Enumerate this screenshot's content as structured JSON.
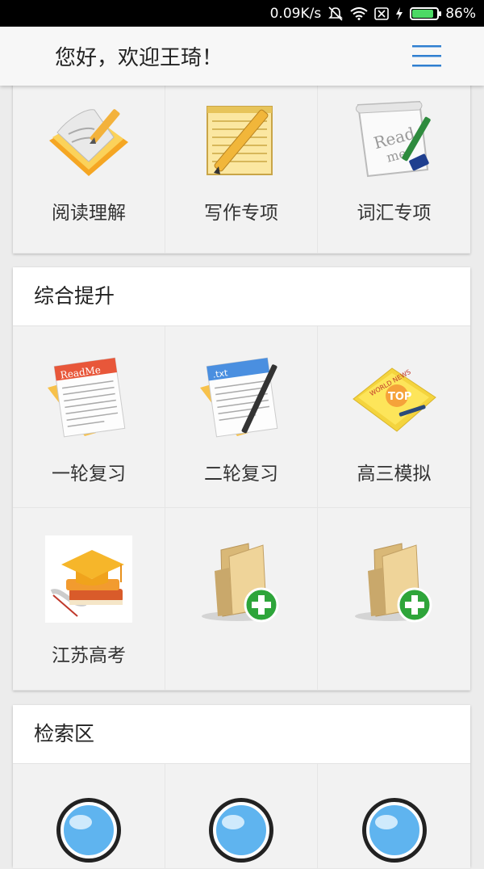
{
  "status_bar": {
    "speed": "0.09K/s",
    "battery": "86%",
    "battery_level": 0.86
  },
  "header": {
    "greeting": "您好，欢迎王琦！",
    "menu_icon": "hamburger-menu-icon"
  },
  "top_card": {
    "items": [
      {
        "label": "阅读理解",
        "icon": "reading-notebook-icon"
      },
      {
        "label": "写作专项",
        "icon": "writing-notepad-icon"
      },
      {
        "label": "词汇专项",
        "icon": "readme-paper-icon"
      }
    ]
  },
  "section_improve": {
    "title": "综合提升",
    "items": [
      {
        "label": "一轮复习",
        "icon": "readme-document-icon"
      },
      {
        "label": "二轮复习",
        "icon": "txt-document-pen-icon"
      },
      {
        "label": "高三模拟",
        "icon": "world-news-top-icon"
      },
      {
        "label": "江苏高考",
        "icon": "graduation-cap-books-icon"
      },
      {
        "label": "",
        "icon": "folder-add-icon"
      },
      {
        "label": "",
        "icon": "folder-add-icon"
      }
    ]
  },
  "section_search": {
    "title": "检索区",
    "items": [
      {
        "icon": "magnifier-icon"
      },
      {
        "icon": "magnifier-icon"
      },
      {
        "icon": "magnifier-icon"
      }
    ]
  },
  "colors": {
    "accent": "#2f7fd0",
    "background": "#ececec",
    "card": "#f2f2f2"
  }
}
